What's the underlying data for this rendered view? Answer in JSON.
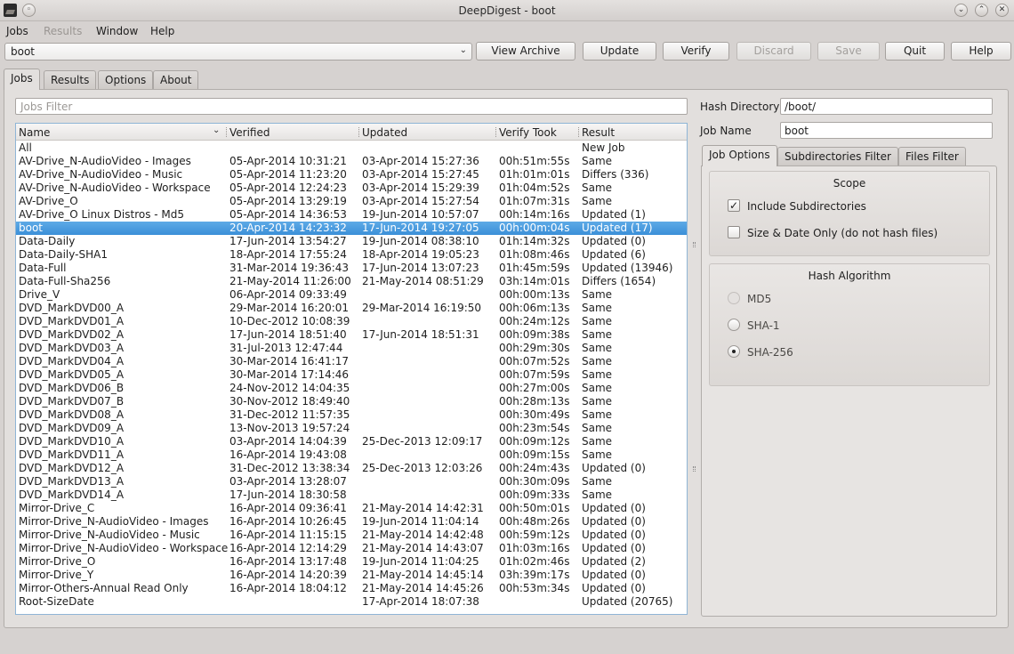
{
  "window": {
    "title": "DeepDigest - boot"
  },
  "menu": [
    {
      "label": "Jobs",
      "enabled": true
    },
    {
      "label": "Results",
      "enabled": false
    },
    {
      "label": "Window",
      "enabled": true
    },
    {
      "label": "Help",
      "enabled": true
    }
  ],
  "toolbar": {
    "job_select": "boot",
    "view_archive": "View Archive",
    "update": "Update",
    "verify": "Verify",
    "discard": "Discard",
    "save": "Save",
    "quit": "Quit",
    "help": "Help"
  },
  "tabs": [
    "Jobs",
    "Results",
    "Options",
    "About"
  ],
  "jobs": {
    "filter_placeholder": "Jobs Filter",
    "columns": [
      "Name",
      "Verified",
      "Updated",
      "Verify Took",
      "Result"
    ],
    "rows": [
      [
        "All",
        "",
        "",
        "",
        "New Job"
      ],
      [
        "AV-Drive_N-AudioVideo - Images",
        "05-Apr-2014 10:31:21",
        "03-Apr-2014 15:27:36",
        "00h:51m:55s",
        "Same"
      ],
      [
        "AV-Drive_N-AudioVideo - Music",
        "05-Apr-2014 11:23:20",
        "03-Apr-2014 15:27:45",
        "01h:01m:01s",
        "Differs (336)"
      ],
      [
        "AV-Drive_N-AudioVideo - Workspace",
        "05-Apr-2014 12:24:23",
        "03-Apr-2014 15:29:39",
        "01h:04m:52s",
        "Same"
      ],
      [
        "AV-Drive_O",
        "05-Apr-2014 13:29:19",
        "03-Apr-2014 15:27:54",
        "01h:07m:31s",
        "Same"
      ],
      [
        "AV-Drive_O Linux Distros - Md5",
        "05-Apr-2014 14:36:53",
        "19-Jun-2014 10:57:07",
        "00h:14m:16s",
        "Updated (1)"
      ],
      [
        "boot",
        "20-Apr-2014 14:23:32",
        "17-Jun-2014 19:27:05",
        "00h:00m:04s",
        "Updated (17)"
      ],
      [
        "Data-Daily",
        "17-Jun-2014 13:54:27",
        "19-Jun-2014 08:38:10",
        "01h:14m:32s",
        "Updated (0)"
      ],
      [
        "Data-Daily-SHA1",
        "18-Apr-2014 17:55:24",
        "18-Apr-2014 19:05:23",
        "01h:08m:46s",
        "Updated (6)"
      ],
      [
        "Data-Full",
        "31-Mar-2014 19:36:43",
        "17-Jun-2014 13:07:23",
        "01h:45m:59s",
        "Updated (13946)"
      ],
      [
        "Data-Full-Sha256",
        "21-May-2014 11:26:00",
        "21-May-2014 08:51:29",
        "03h:14m:01s",
        "Differs (1654)"
      ],
      [
        "Drive_V",
        "06-Apr-2014 09:33:49",
        "",
        "00h:00m:13s",
        "Same"
      ],
      [
        "DVD_MarkDVD00_A",
        "29-Mar-2014 16:20:01",
        "29-Mar-2014 16:19:50",
        "00h:06m:13s",
        "Same"
      ],
      [
        "DVD_MarkDVD01_A",
        "10-Dec-2012 10:08:39",
        "",
        "00h:24m:12s",
        "Same"
      ],
      [
        "DVD_MarkDVD02_A",
        "17-Jun-2014 18:51:40",
        "17-Jun-2014 18:51:31",
        "00h:09m:38s",
        "Same"
      ],
      [
        "DVD_MarkDVD03_A",
        "31-Jul-2013 12:47:44",
        "",
        "00h:29m:30s",
        "Same"
      ],
      [
        "DVD_MarkDVD04_A",
        "30-Mar-2014 16:41:17",
        "",
        "00h:07m:52s",
        "Same"
      ],
      [
        "DVD_MarkDVD05_A",
        "30-Mar-2014 17:14:46",
        "",
        "00h:07m:59s",
        "Same"
      ],
      [
        "DVD_MarkDVD06_B",
        "24-Nov-2012 14:04:35",
        "",
        "00h:27m:00s",
        "Same"
      ],
      [
        "DVD_MarkDVD07_B",
        "30-Nov-2012 18:49:40",
        "",
        "00h:28m:13s",
        "Same"
      ],
      [
        "DVD_MarkDVD08_A",
        "31-Dec-2012 11:57:35",
        "",
        "00h:30m:49s",
        "Same"
      ],
      [
        "DVD_MarkDVD09_A",
        "13-Nov-2013 19:57:24",
        "",
        "00h:23m:54s",
        "Same"
      ],
      [
        "DVD_MarkDVD10_A",
        "03-Apr-2014 14:04:39",
        "25-Dec-2013 12:09:17",
        "00h:09m:12s",
        "Same"
      ],
      [
        "DVD_MarkDVD11_A",
        "16-Apr-2014 19:43:08",
        "",
        "00h:09m:15s",
        "Same"
      ],
      [
        "DVD_MarkDVD12_A",
        "31-Dec-2012 13:38:34",
        "25-Dec-2013 12:03:26",
        "00h:24m:43s",
        "Updated (0)"
      ],
      [
        "DVD_MarkDVD13_A",
        "03-Apr-2014 13:28:07",
        "",
        "00h:30m:09s",
        "Same"
      ],
      [
        "DVD_MarkDVD14_A",
        "17-Jun-2014 18:30:58",
        "",
        "00h:09m:33s",
        "Same"
      ],
      [
        "Mirror-Drive_C",
        "16-Apr-2014 09:36:41",
        "21-May-2014 14:42:31",
        "00h:50m:01s",
        "Updated (0)"
      ],
      [
        "Mirror-Drive_N-AudioVideo - Images",
        "16-Apr-2014 10:26:45",
        "19-Jun-2014 11:04:14",
        "00h:48m:26s",
        "Updated (0)"
      ],
      [
        "Mirror-Drive_N-AudioVideo - Music",
        "16-Apr-2014 11:15:15",
        "21-May-2014 14:42:48",
        "00h:59m:12s",
        "Updated (0)"
      ],
      [
        "Mirror-Drive_N-AudioVideo - Workspace",
        "16-Apr-2014 12:14:29",
        "21-May-2014 14:43:07",
        "01h:03m:16s",
        "Updated (0)"
      ],
      [
        "Mirror-Drive_O",
        "16-Apr-2014 13:17:48",
        "19-Jun-2014 11:04:25",
        "01h:02m:46s",
        "Updated (2)"
      ],
      [
        "Mirror-Drive_Y",
        "16-Apr-2014 14:20:39",
        "21-May-2014 14:45:14",
        "03h:39m:17s",
        "Updated (0)"
      ],
      [
        "Mirror-Others-Annual Read Only",
        "16-Apr-2014 18:04:12",
        "21-May-2014 14:45:26",
        "00h:53m:34s",
        "Updated (0)"
      ],
      [
        "Root-SizeDate",
        "",
        "17-Apr-2014 18:07:38",
        "",
        "Updated (20765)"
      ]
    ],
    "selected_row": 6
  },
  "details": {
    "hash_directory_label": "Hash Directory",
    "hash_directory_value": "/boot/",
    "job_name_label": "Job Name",
    "job_name_value": "boot",
    "subtabs": [
      "Job Options",
      "Subdirectories Filter",
      "Files Filter"
    ],
    "scope": {
      "title": "Scope",
      "include_subdirectories": {
        "label": "Include Subdirectories",
        "checked": true
      },
      "size_date_only": {
        "label": "Size & Date Only (do not hash files)",
        "checked": false
      }
    },
    "hash_algorithm": {
      "title": "Hash Algorithm",
      "options": [
        "MD5",
        "SHA-1",
        "SHA-256"
      ],
      "selected": "SHA-256"
    }
  }
}
